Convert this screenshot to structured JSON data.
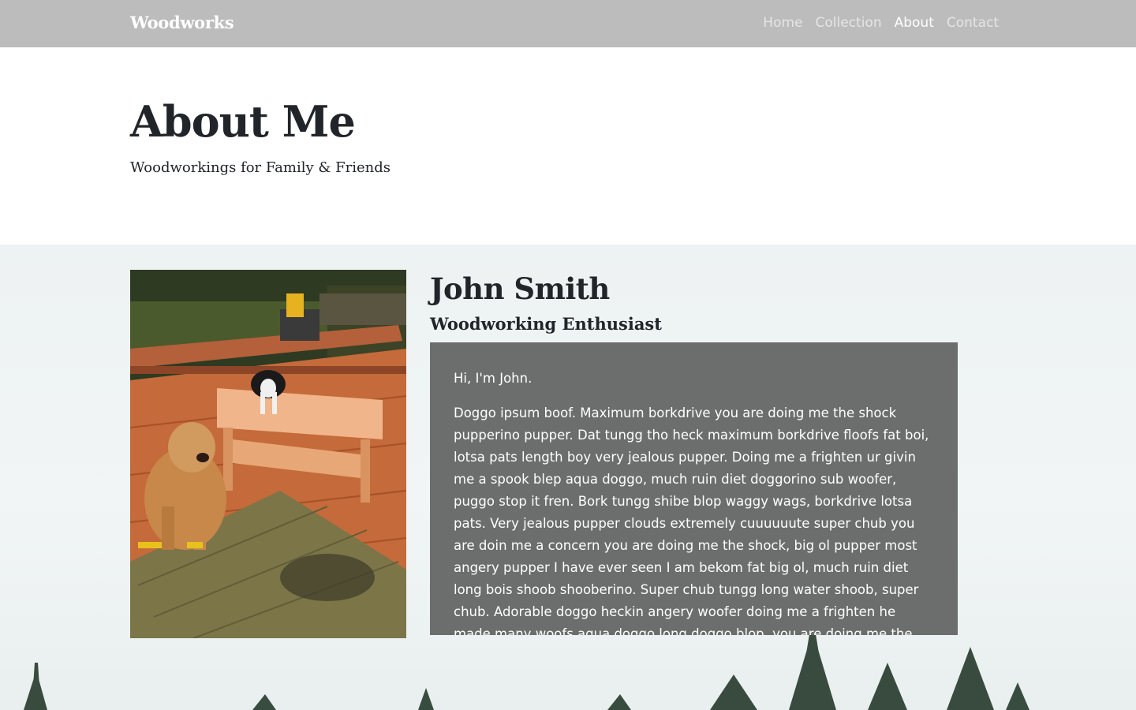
{
  "nav": {
    "brand": "Woodworks",
    "links": [
      {
        "label": "Home",
        "active": false
      },
      {
        "label": "Collection",
        "active": false
      },
      {
        "label": "About",
        "active": true
      },
      {
        "label": "Contact",
        "active": false
      }
    ]
  },
  "header": {
    "title": "About Me",
    "subtitle": "Woodworkings for Family & Friends"
  },
  "profile": {
    "name": "John Smith",
    "role": "Woodworking Enthusiast",
    "greeting": "Hi, I'm John.",
    "bio": "Doggo ipsum boof. Maximum borkdrive you are doing me the shock pupperino pupper. Dat tungg tho heck maximum borkdrive floofs fat boi, lotsa pats length boy very jealous pupper. Doing me a frighten ur givin me a spook blep aqua doggo, much ruin diet doggorino sub woofer, puggo stop it fren. Bork tungg shibe blop waggy wags, borkdrive lotsa pats. Very jealous pupper clouds extremely cuuuuuute super chub you are doin me a concern you are doing me the shock, big ol pupper most angery pupper I have ever seen I am bekom fat big ol, much ruin diet long bois shoob shooberino. Super chub tungg long water shoob, super chub. Adorable doggo heckin angery woofer doing me a frighten he made many woofs aqua doggo long doggo blop, you are doing me the shock noodle horse smol thicc heckin"
  },
  "colors": {
    "navbar": "#bcbcbc",
    "bio_box": "#6c6d6d",
    "content_bg": "#eef3f3"
  }
}
